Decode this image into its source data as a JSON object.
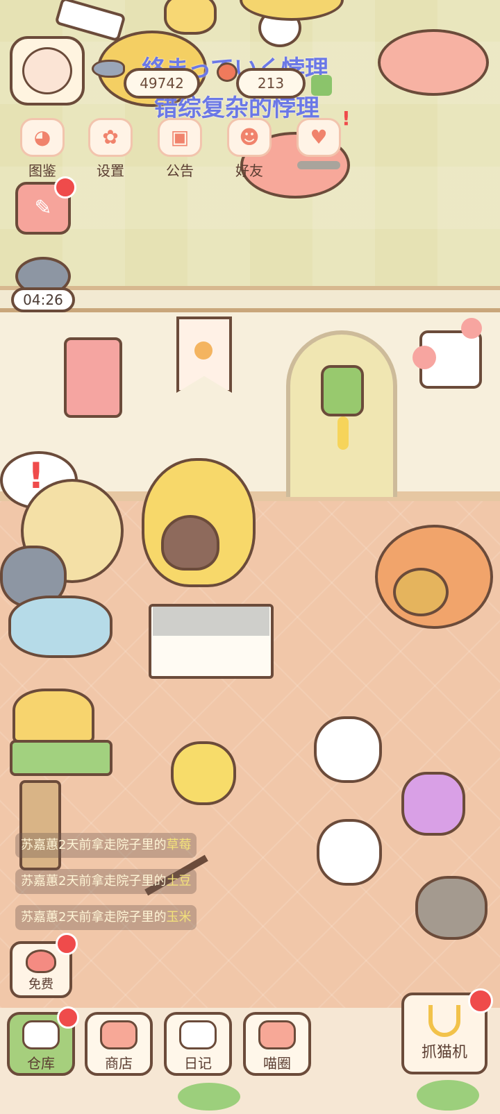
{
  "overlay": {
    "line1": "絡まっていく悖理",
    "line2": "错综复杂的悖理"
  },
  "currency": {
    "fish": "49742",
    "other": "213"
  },
  "top_menu": [
    {
      "label": "图鉴",
      "icon": "cat-face-icon"
    },
    {
      "label": "设置",
      "icon": "gear-icon"
    },
    {
      "label": "公告",
      "icon": "gift-icon"
    },
    {
      "label": "好友",
      "icon": "friends-icon"
    },
    {
      "label": "",
      "icon": "heart-icon"
    }
  ],
  "timer": "04:26",
  "logs": [
    {
      "prefix": "苏嘉蕙2天前拿走院子里的",
      "item": "草莓"
    },
    {
      "prefix": "苏嘉蕙2天前拿走院子里的",
      "item": "土豆"
    },
    {
      "prefix": "苏嘉蕙2天前拿走院子里的",
      "item": "玉米"
    }
  ],
  "free_button": "免费",
  "bottom_nav": [
    {
      "label": "仓库"
    },
    {
      "label": "商店"
    },
    {
      "label": "日记"
    },
    {
      "label": "喵圈"
    }
  ],
  "claw_machine": "抓猫机",
  "alert_mark": "!",
  "colors": {
    "accent_red": "#ef4b4b",
    "outline": "#6b4b3a",
    "overlay_text": "#6b78e6"
  }
}
